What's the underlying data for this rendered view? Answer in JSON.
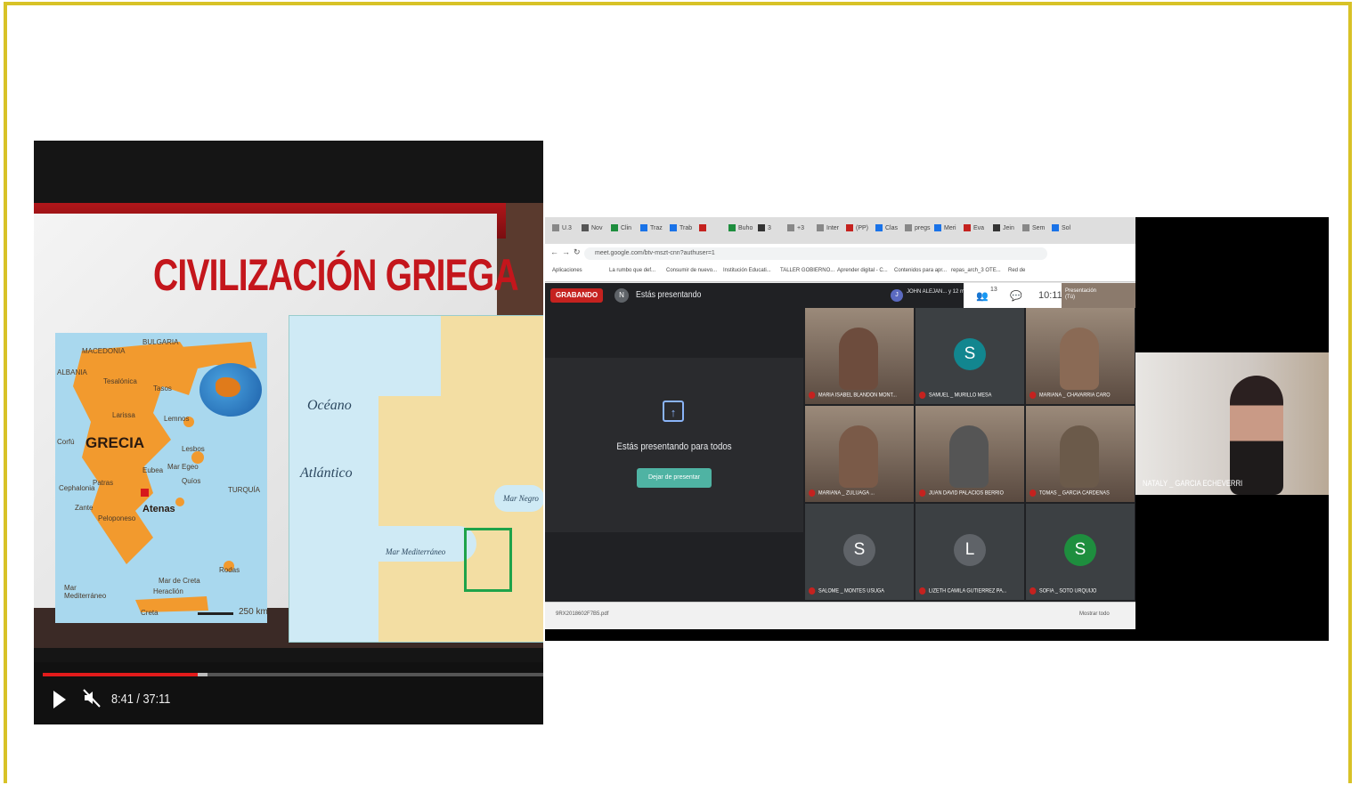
{
  "video": {
    "slide_title": "CIVILIZACIÓN GRIEGA",
    "map_greece": {
      "labels": [
        "MACEDONIA",
        "BULGARIA",
        "ALBANIA",
        "Tesalónica",
        "Tasos",
        "Larissa",
        "Lemnos",
        "Corfú",
        "Lesbos",
        "Eubea",
        "Mar Egeo",
        "Quíos",
        "Cephalonia",
        "Patras",
        "TURQUÍA",
        "Zante",
        "Peloponeso",
        "Rodas",
        "Mar de Creta",
        "Mar Mediterráneo",
        "Heraclión",
        "Creta"
      ],
      "country": "GRECIA",
      "capital": "Atenas",
      "scale": "250 km"
    },
    "map_europe": {
      "ocean_line1": "Océano",
      "ocean_line2": "Atlántico",
      "sea_black": "Mar Negro",
      "sea_med": "Mar Mediterráneo"
    },
    "time": "8:41 / 37:11",
    "progress_played": 0.31,
    "progress_buffered": 0.33
  },
  "meet": {
    "url": "meet.google.com/btv-mszt-cnn?authuser=1",
    "tabs": [
      "U.3",
      "Nov",
      "Clin",
      "Traz",
      "Trab",
      "",
      "Buho",
      "3",
      "+3",
      "Inter",
      "(PP)",
      "Clas",
      "pregs",
      "Meri",
      "Eva",
      "Jein",
      "Sem",
      "Sol"
    ],
    "bookmarks": [
      "Aplicaciones",
      "La rumbo que def...",
      "Consumir de nuevo...",
      "Institución Educati...",
      "TALLER GOBIERNO...",
      "Aprender digital - C...",
      "Contenidos para apr...",
      "repas_arch_3 OTE...",
      "Red de"
    ],
    "recording_label": "GRABANDO",
    "presenter_initial": "N",
    "presenting_label": "Estás presentando",
    "joined_text": "JOHN ALEJAN... y 12 más",
    "joined_initial": "J",
    "participants_count": "13",
    "clock": "10:11",
    "self_label": "Presentación (Tú)",
    "present_message": "Estás presentando para todos",
    "stop_button": "Dejar de presentar",
    "participants": [
      {
        "name": "MARIA ISABEL BLANDON MONT...",
        "initial": "",
        "color": "#6d4c3d"
      },
      {
        "name": "SAMUEL _ MURILLO MESA",
        "initial": "S",
        "color": "#12868f"
      },
      {
        "name": "MARIANA _ CHAVARRIA CARO",
        "initial": "",
        "color": "#8a6a55"
      },
      {
        "name": "MARIANA _ ZULUAGA ...",
        "initial": "",
        "color": "#7a5a48"
      },
      {
        "name": "JUAN DAVID PALACIOS BERRIO",
        "initial": "",
        "color": "#555"
      },
      {
        "name": "TOMAS _ GARCIA CARDENAS",
        "initial": "",
        "color": "#6b5a4a"
      },
      {
        "name": "SALOME _ MONTES USUGA",
        "initial": "S",
        "color": "#5f6368"
      },
      {
        "name": "LIZETH CAMILA GUTIERREZ PA...",
        "initial": "L",
        "color": "#5f6368"
      },
      {
        "name": "SOFIA _ SOTO URQUIJO",
        "initial": "S",
        "color": "#1e8e3e"
      }
    ],
    "download_file": "9RX2018602F7B5.pdf",
    "download_all": "Mostrar todo",
    "teacher_name": "NATALY _ GARCIA ECHEVERRI"
  }
}
